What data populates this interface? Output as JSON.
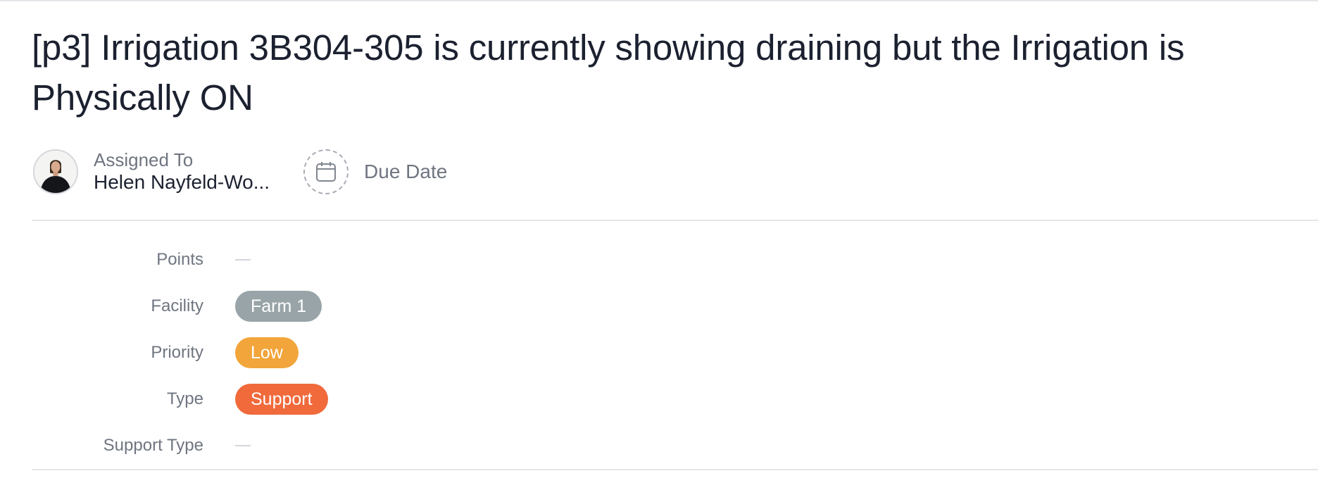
{
  "task": {
    "title": "[p3]  Irrigation 3B304-305 is currently showing draining but the Irrigation is Physically ON"
  },
  "assignee": {
    "label": "Assigned To",
    "name": "Helen Nayfeld-Wo..."
  },
  "due_date": {
    "label": "Due Date",
    "icon": "calendar-icon"
  },
  "fields": {
    "points": {
      "label": "Points",
      "value": ""
    },
    "facility": {
      "label": "Facility",
      "value": "Farm 1",
      "color": "#98a4a7"
    },
    "priority": {
      "label": "Priority",
      "value": "Low",
      "color": "#f2a53a"
    },
    "type": {
      "label": "Type",
      "value": "Support",
      "color": "#f06a3c"
    },
    "support_type": {
      "label": "Support Type",
      "value": ""
    }
  }
}
